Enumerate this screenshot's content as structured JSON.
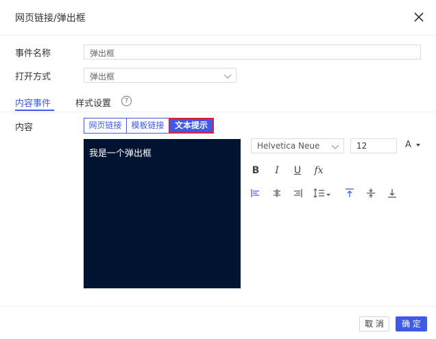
{
  "dialog": {
    "title": "网页链接/弹出框"
  },
  "form": {
    "event_name_label": "事件名称",
    "event_name_value": "弹出框",
    "open_mode_label": "打开方式",
    "open_mode_value": "弹出框",
    "content_label": "内容"
  },
  "tabs": [
    {
      "label": "内容事件",
      "active": true
    },
    {
      "label": "样式设置",
      "active": false
    }
  ],
  "help_glyph": "?",
  "content_types": [
    {
      "label": "网页链接",
      "active": false
    },
    {
      "label": "模板链接",
      "active": false
    },
    {
      "label": "文本提示",
      "active": true
    }
  ],
  "editor": {
    "text": "我是一个弹出框",
    "background": "#001330"
  },
  "toolbar": {
    "font_family": "Helvetica Neue",
    "font_size": "12",
    "font_color_glyph": "A",
    "bold_glyph": "B",
    "italic_glyph": "I",
    "underline_glyph": "U",
    "formula_glyph": "fx",
    "icons": [
      "bold-icon",
      "italic-icon",
      "underline-icon",
      "formula-icon",
      "align-left-icon",
      "align-center-icon",
      "align-right-icon",
      "line-spacing-icon",
      "align-top-icon",
      "align-middle-icon",
      "align-bottom-icon"
    ]
  },
  "footer": {
    "cancel_label": "取 消",
    "ok_label": "确 定"
  },
  "colors": {
    "accent": "#3e5ae6",
    "highlight_border": "#e0213a"
  }
}
